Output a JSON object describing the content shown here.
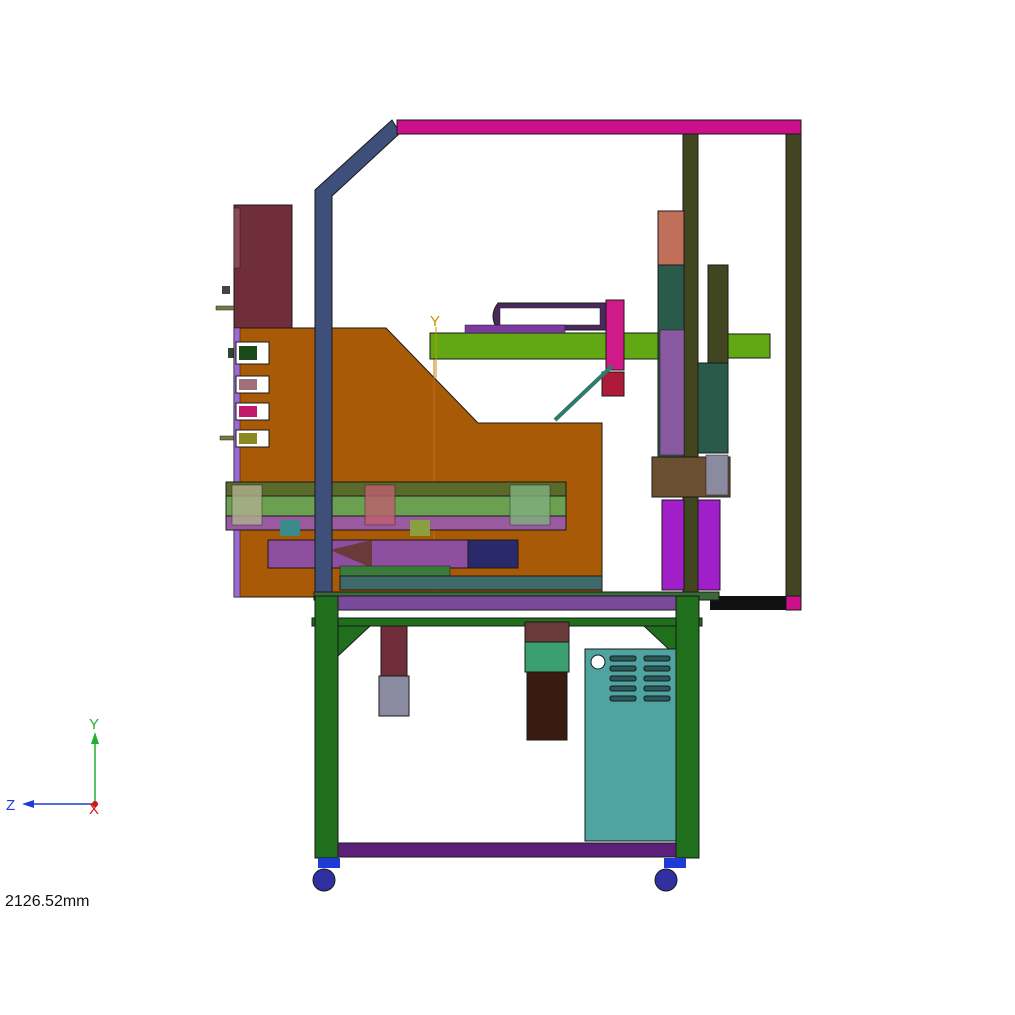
{
  "triad": {
    "y_label": "Y",
    "z_label": "Z",
    "x_label": "X",
    "y_color": "#22b02a",
    "z_color": "#1f3bd6",
    "x_color": "#d01818"
  },
  "origin_marker": {
    "label": "Y",
    "color": "#c89000"
  },
  "scale_readout": "2126.52mm",
  "colors": {
    "frame_outline": "#1a1a1a",
    "top_beam": "#cc0f8a",
    "diagonal_post": "#3e4f7a",
    "rear_post": "#414620",
    "stand_green": "#1f6f1c",
    "stand_crossbar": "#5c1f7a",
    "orange_panel": "#a85a06",
    "panel_box": "#6f2e3a",
    "gantry_arm": "#62a814",
    "cabinet": "#4fa3a0",
    "motor_dark": "#3b1a12",
    "column_purple": "#a01fc8"
  }
}
